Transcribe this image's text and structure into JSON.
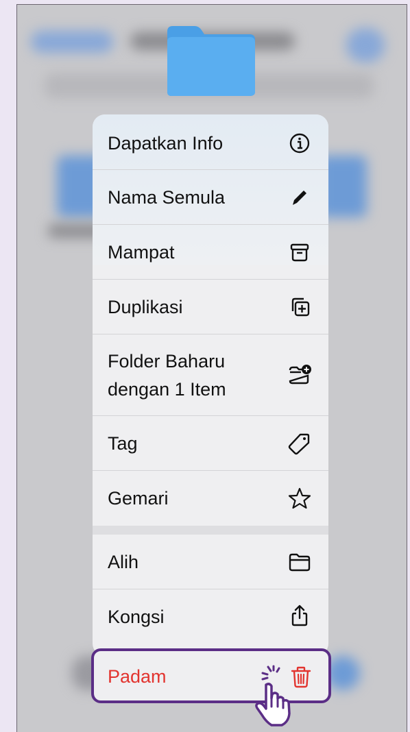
{
  "menu": {
    "items": [
      {
        "label": "Dapatkan Info",
        "icon": "info-icon"
      },
      {
        "label": "Nama Semula",
        "icon": "pencil-icon"
      },
      {
        "label": "Mampat",
        "icon": "archive-box-icon"
      },
      {
        "label": "Duplikasi",
        "icon": "duplicate-plus-icon"
      },
      {
        "label1": "Folder Baharu",
        "label2": "dengan 1 Item",
        "icon": "folder-badge-plus-icon"
      },
      {
        "label": "Tag",
        "icon": "tag-icon"
      },
      {
        "label": "Gemari",
        "icon": "star-icon"
      },
      {
        "label": "Alih",
        "icon": "folder-icon"
      },
      {
        "label": "Kongsi",
        "icon": "share-icon"
      }
    ],
    "delete": {
      "label": "Padam",
      "icon": "trash-icon",
      "color": "#e2342f"
    }
  },
  "colors": {
    "highlight_border": "#5b2e86",
    "folder": "#5aaef0"
  }
}
